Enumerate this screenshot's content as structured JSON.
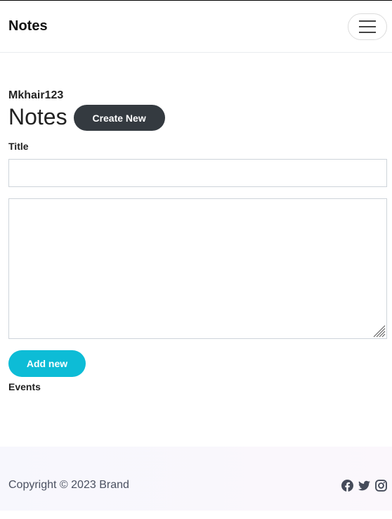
{
  "navbar": {
    "brand": "Notes",
    "toggle_icon": "hamburger-menu-icon"
  },
  "main": {
    "username": "Mkhair123",
    "page_title": "Notes",
    "create_new_label": "Create New",
    "title_label": "Title",
    "title_input": {
      "value": "",
      "placeholder": ""
    },
    "body_textarea": {
      "value": "",
      "placeholder": ""
    },
    "add_new_label": "Add new",
    "events_label": "Events"
  },
  "footer": {
    "copyright": "Copyright © 2023 Brand",
    "socials": [
      "facebook-icon",
      "twitter-icon",
      "instagram-icon"
    ]
  },
  "colors": {
    "dark_button": "#343a40",
    "info_button": "#0dbcd6",
    "footer_text": "#4a5060"
  }
}
